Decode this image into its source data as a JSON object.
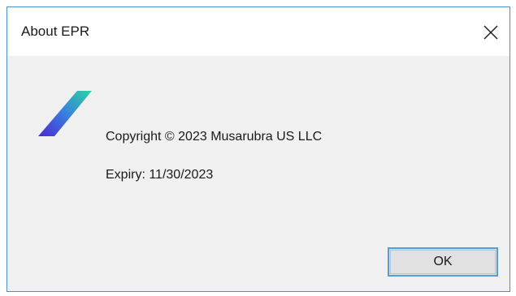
{
  "dialog": {
    "title": "About EPR",
    "close_icon": "close-icon",
    "logo_icon": "epr-logo-icon",
    "copyright": "Copyright © 2023 Musarubra US LLC",
    "expiry": "Expiry: 11/30/2023",
    "ok_label": "OK"
  },
  "colors": {
    "window_border": "#4b8bd2",
    "body_background": "#f0f0f0",
    "titlebar_background": "#ffffff",
    "button_focus_border": "#5b9bd5",
    "logo_gradient": [
      "#2bd4a0",
      "#3a7ee0",
      "#4a2ad0"
    ]
  }
}
